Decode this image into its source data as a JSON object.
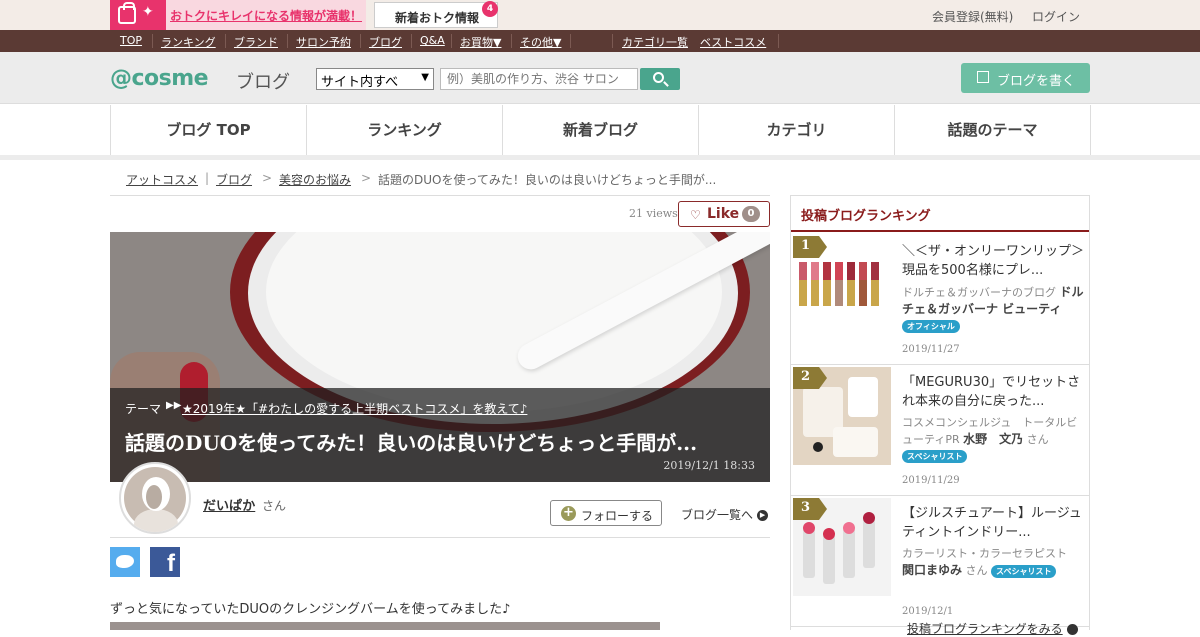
{
  "promo": {
    "text": "おトクにキレイになる情報が満載！",
    "new_info_label": "新着おトク情報",
    "new_info_count": "4"
  },
  "account": {
    "register": "会員登録(無料)",
    "login": "ログイン"
  },
  "topnav": {
    "items": [
      "TOP",
      "ランキング",
      "ブランド",
      "サロン予約",
      "ブログ",
      "Q&A",
      "お買物▼",
      "その他▼"
    ],
    "right_items": [
      "カテゴリ一覧",
      "ベストコスメ"
    ]
  },
  "header": {
    "logo": "@cosme",
    "logo_sub": "ブログ",
    "select_value": "サイト内すべ",
    "search_placeholder": "例）美肌の作り方、渋谷 サロン",
    "write_button": "ブログを書く"
  },
  "tabs": [
    "ブログ TOP",
    "ランキング",
    "新着ブログ",
    "カテゴリ",
    "話題のテーマ"
  ],
  "breadcrumb": {
    "items": [
      "アットコスメ",
      "ブログ",
      "美容のお悩み"
    ],
    "current": "話題のDUOを使ってみた！良いのは良いけどちょっと手間が..."
  },
  "post": {
    "views": "21 views",
    "like_label": "Like",
    "like_count": "0",
    "theme_label": "テーマ",
    "theme_link": "★2019年★「#わたしの愛する上半期ベストコスメ」を教えて♪",
    "title": "話題のDUOを使ってみた！良いのは良いけどちょっと手間が...",
    "date": "2019/12/1 18:33",
    "author": "だいぱか",
    "author_suffix": "さん",
    "follow_label": "フォローする",
    "blog_list_label": "ブログ一覧へ",
    "body_text": "ずっと気になっていたDUOのクレンジングバームを使ってみました♪"
  },
  "sidebar": {
    "title": "投稿ブログランキング",
    "items": [
      {
        "rank": "1",
        "title": "＼＜ザ・オンリーワンリップ＞現品を500名様にプレ...",
        "author_prefix": "ドルチェ＆ガッバーナのブログ",
        "author": "ドルチェ＆ガッバーナ ビューティ",
        "author_suffix": "",
        "badge": "オフィシャル",
        "date": "2019/11/27"
      },
      {
        "rank": "2",
        "title": "「MEGURU30」でリセットされ本来の自分に戻った...",
        "author_prefix": "コスメコンシェルジュ　トータルビューティPR",
        "author": "水野　文乃",
        "author_suffix": "さん",
        "badge": "スペシャリスト",
        "date": "2019/11/29"
      },
      {
        "rank": "3",
        "title": "【ジルスチュアート】ルージュ ティントインドリー...",
        "author_prefix": "カラーリスト・カラーセラピスト",
        "author": "関口まゆみ",
        "author_suffix": "さん",
        "badge": "スペシャリスト",
        "date": "2019/12/1"
      }
    ],
    "more_label": "投稿ブログランキングをみる"
  },
  "colors": {
    "accent": "#4aa58d",
    "brand_brown": "#5b3a34",
    "promo_pink": "#e8336c",
    "ranking_red": "#8a1b1b"
  }
}
